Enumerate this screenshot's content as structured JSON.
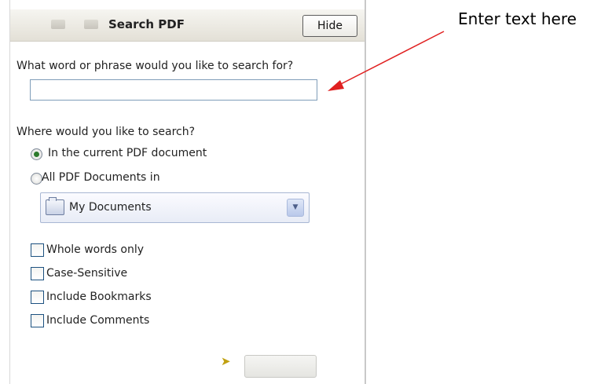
{
  "panel": {
    "title": "Search PDF",
    "hide_label": "Hide"
  },
  "search": {
    "question": "What word or phrase would you like to search for?",
    "value": "",
    "placeholder": ""
  },
  "scope": {
    "question": "Where would you like to search?",
    "options": [
      {
        "label": "In the current PDF document",
        "selected": true
      },
      {
        "label": "All PDF Documents in",
        "selected": false
      }
    ],
    "location": "My Documents"
  },
  "options": [
    {
      "label": "Whole words only",
      "checked": false
    },
    {
      "label": "Case-Sensitive",
      "checked": false
    },
    {
      "label": "Include Bookmarks",
      "checked": false
    },
    {
      "label": "Include Comments",
      "checked": false
    }
  ],
  "annotation": {
    "text": "Enter text here",
    "color": "#e02020"
  },
  "icons": {
    "pointer": "arrow-icon",
    "location_dropdown": "chevron-down-icon"
  }
}
